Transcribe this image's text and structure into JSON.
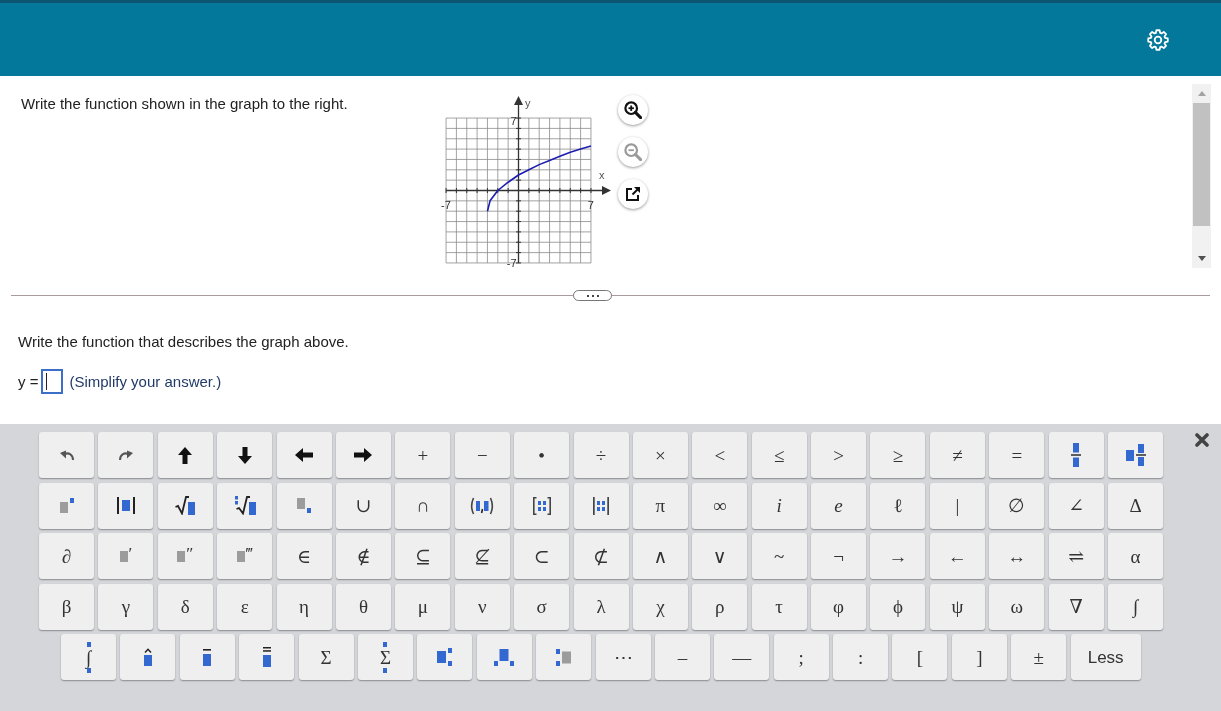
{
  "question": {
    "text": "Write the function shown in the graph to the right.",
    "graph": {
      "chart_data": {
        "type": "line",
        "xlabel": "x",
        "ylabel": "y",
        "xlim": [
          -7,
          7
        ],
        "ylim": [
          -7,
          7
        ],
        "xticks": [
          -7,
          7
        ],
        "yticks": [
          -7,
          7
        ],
        "grid": true,
        "color": "#1c1cb0",
        "x": [
          -3,
          -2.75,
          -2,
          -1,
          0,
          1,
          2,
          3,
          4,
          5,
          6,
          7
        ],
        "values": [
          -2,
          -1,
          0,
          0.8,
          1.5,
          2,
          2.5,
          2.9,
          3.3,
          3.7,
          4,
          4.3
        ]
      }
    },
    "graph_tools": [
      {
        "kind": "zoom-in",
        "disabled": false
      },
      {
        "kind": "zoom-out",
        "disabled": true
      },
      {
        "kind": "popout",
        "disabled": false
      }
    ]
  },
  "prompt": {
    "text": "Write the function that describes the graph above.",
    "answer": {
      "label": "y =",
      "focused": true,
      "note": "(Simplify your answer.)"
    }
  },
  "keyboard": {
    "rows": [
      [
        {
          "kind": "undo"
        },
        {
          "kind": "redo"
        },
        {
          "kind": "up"
        },
        {
          "kind": "down"
        },
        {
          "kind": "left"
        },
        {
          "kind": "right"
        },
        {
          "kind": "symbol",
          "label": "+"
        },
        {
          "kind": "symbol",
          "label": "−"
        },
        {
          "kind": "symbol",
          "label": "•"
        },
        {
          "kind": "symbol",
          "label": "÷"
        },
        {
          "kind": "symbol",
          "label": "×"
        },
        {
          "kind": "symbol",
          "label": "<"
        },
        {
          "kind": "symbol",
          "label": "≤"
        },
        {
          "kind": "symbol",
          "label": ">"
        },
        {
          "kind": "symbol",
          "label": "≥"
        },
        {
          "kind": "symbol",
          "label": "≠"
        },
        {
          "kind": "symbol",
          "label": "="
        },
        {
          "kind": "fraction"
        },
        {
          "kind": "mixed"
        }
      ],
      [
        {
          "kind": "power"
        },
        {
          "kind": "abs"
        },
        {
          "kind": "sqrt"
        },
        {
          "kind": "nthroot"
        },
        {
          "kind": "subscript"
        },
        {
          "kind": "symbol",
          "label": "∪"
        },
        {
          "kind": "symbol",
          "label": "∩"
        },
        {
          "kind": "interval"
        },
        {
          "kind": "matrix"
        },
        {
          "kind": "determinant"
        },
        {
          "kind": "symbol",
          "label": "π"
        },
        {
          "kind": "symbol",
          "label": "∞"
        },
        {
          "kind": "variable",
          "label": "i"
        },
        {
          "kind": "variable",
          "label": "e"
        },
        {
          "kind": "symbol",
          "label": "ℓ"
        },
        {
          "kind": "symbol",
          "label": "|"
        },
        {
          "kind": "symbol",
          "label": "∅"
        },
        {
          "kind": "symbol",
          "label": "∠"
        },
        {
          "kind": "symbol",
          "label": "Δ"
        }
      ],
      [
        {
          "kind": "symbol",
          "label": "∂"
        },
        {
          "kind": "prime",
          "label": "′"
        },
        {
          "kind": "prime",
          "label": "″"
        },
        {
          "kind": "prime",
          "label": "‴"
        },
        {
          "kind": "symbol",
          "label": "∈"
        },
        {
          "kind": "symbol",
          "label": "∉"
        },
        {
          "kind": "symbol",
          "label": "⊆"
        },
        {
          "kind": "symbol",
          "label": "⊈"
        },
        {
          "kind": "symbol",
          "label": "⊂"
        },
        {
          "kind": "symbol",
          "label": "⊄"
        },
        {
          "kind": "symbol",
          "label": "∧"
        },
        {
          "kind": "symbol",
          "label": "∨"
        },
        {
          "kind": "symbol",
          "label": "~"
        },
        {
          "kind": "symbol",
          "label": "¬"
        },
        {
          "kind": "symbol",
          "label": "→"
        },
        {
          "kind": "symbol",
          "label": "←"
        },
        {
          "kind": "symbol",
          "label": "↔"
        },
        {
          "kind": "symbol",
          "label": "⇌"
        },
        {
          "kind": "symbol",
          "label": "α"
        }
      ],
      [
        {
          "kind": "symbol",
          "label": "β"
        },
        {
          "kind": "symbol",
          "label": "γ"
        },
        {
          "kind": "symbol",
          "label": "δ"
        },
        {
          "kind": "symbol",
          "label": "ε"
        },
        {
          "kind": "symbol",
          "label": "η"
        },
        {
          "kind": "symbol",
          "label": "θ"
        },
        {
          "kind": "symbol",
          "label": "μ"
        },
        {
          "kind": "symbol",
          "label": "ν"
        },
        {
          "kind": "symbol",
          "label": "σ"
        },
        {
          "kind": "symbol",
          "label": "λ"
        },
        {
          "kind": "symbol",
          "label": "χ"
        },
        {
          "kind": "symbol",
          "label": "ρ"
        },
        {
          "kind": "symbol",
          "label": "τ"
        },
        {
          "kind": "symbol",
          "label": "φ"
        },
        {
          "kind": "symbol",
          "label": "ϕ"
        },
        {
          "kind": "symbol",
          "label": "ψ"
        },
        {
          "kind": "symbol",
          "label": "ω"
        },
        {
          "kind": "symbol",
          "label": "∇"
        },
        {
          "kind": "symbol",
          "label": "∫"
        }
      ],
      [
        {
          "kind": "limits",
          "label": "∫"
        },
        {
          "kind": "hat"
        },
        {
          "kind": "bar"
        },
        {
          "kind": "doublebar"
        },
        {
          "kind": "symbol",
          "label": "Σ"
        },
        {
          "kind": "limits",
          "label": "Σ"
        },
        {
          "kind": "subsup"
        },
        {
          "kind": "lowerpair"
        },
        {
          "kind": "presubsup"
        },
        {
          "kind": "symbol",
          "label": "⋯"
        },
        {
          "kind": "symbol",
          "label": "–"
        },
        {
          "kind": "symbol",
          "label": "—"
        },
        {
          "kind": "symbol",
          "label": ";"
        },
        {
          "kind": "symbol",
          "label": ":"
        },
        {
          "kind": "symbol",
          "label": "["
        },
        {
          "kind": "symbol",
          "label": "]"
        },
        {
          "kind": "symbol",
          "label": "±"
        },
        {
          "kind": "toggle",
          "label": "Less"
        }
      ]
    ]
  }
}
